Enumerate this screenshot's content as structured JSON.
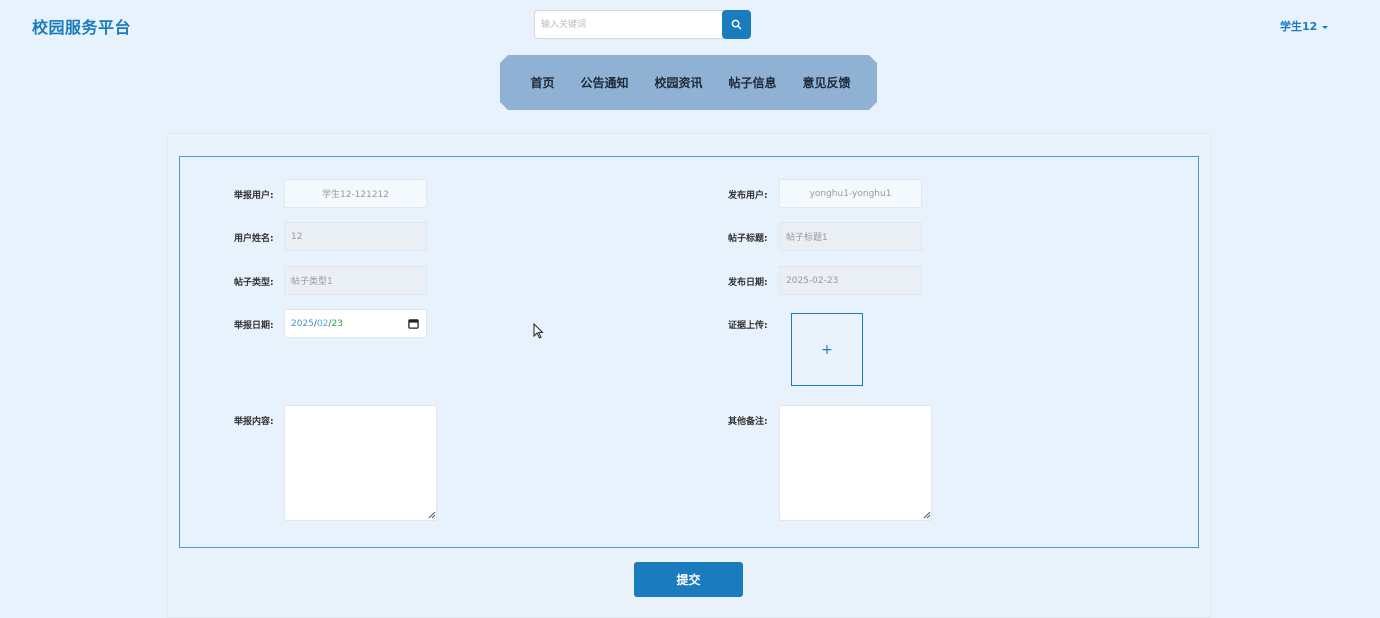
{
  "header": {
    "brand": "校园服务平台",
    "search": {
      "placeholder": "输入关键词",
      "value": ""
    },
    "user": "学生12"
  },
  "nav": {
    "items": [
      "首页",
      "公告通知",
      "校园资讯",
      "帖子信息",
      "意见反馈"
    ]
  },
  "form": {
    "reporter_label": "举报用户:",
    "reporter_value": "学生12-121212",
    "publisher_label": "发布用户:",
    "publisher_value": "yonghu1-yonghu1",
    "name_label": "用户姓名:",
    "name_value": "12",
    "post_title_label": "帖子标题:",
    "post_title_value": "帖子标题1",
    "post_type_label": "帖子类型:",
    "post_type_value": "帖子类型1",
    "publish_date_label": "发布日期:",
    "publish_date_value": "2025-02-23",
    "report_date_label": "举报日期:",
    "report_date": {
      "year": "2025",
      "month": "02",
      "day": "23",
      "sep": "/"
    },
    "evidence_label": "证据上传:",
    "evidence_plus": "+",
    "content_label": "举报内容:",
    "remarks_label": "其他备注:",
    "submit": "提交"
  },
  "colors": {
    "accent": "#1a7bbf",
    "nav_bg": "#8fb1d3",
    "page_bg": "#e8f2fc"
  },
  "icons": [
    "search-icon",
    "caret-down-icon",
    "calendar-icon",
    "plus-icon",
    "resize-grip-icon",
    "mouse-cursor-icon"
  ]
}
